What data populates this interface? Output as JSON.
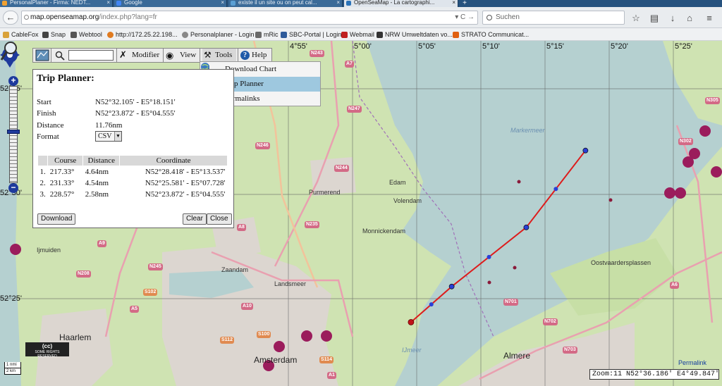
{
  "browser": {
    "tabs": [
      {
        "label": "PersonalPlaner - Firma: NEDT..."
      },
      {
        "label": "Google"
      },
      {
        "label": "existe il un site ou on peut cal..."
      },
      {
        "label": "OpenSeaMap - La cartographi..."
      }
    ],
    "url_host": "map.openseamap.org",
    "url_path": "/index.php?lang=fr",
    "search_placeholder": "Suchen",
    "bookmarks": [
      {
        "label": "CableFox",
        "color": "#d9a23a"
      },
      {
        "label": "Snap",
        "color": "#444444"
      },
      {
        "label": "Webtool",
        "color": "#555555"
      },
      {
        "label": "http://172.25.22.198...",
        "color": "#e07b20"
      },
      {
        "label": "Personalplaner - Login",
        "color": "#888888"
      },
      {
        "label": "mRic",
        "color": "#6a6a6a"
      },
      {
        "label": "SBC-Portal | Login",
        "color": "#2f5b9a"
      },
      {
        "label": "Webmail",
        "color": "#c02020"
      },
      {
        "label": "NRW Umweltdaten vo...",
        "color": "#333333"
      },
      {
        "label": "STRATO Communicat...",
        "color": "#e06010"
      }
    ]
  },
  "toolbar": {
    "modifier": "Modifier",
    "view": "View",
    "tools": "Tools",
    "help": "Help"
  },
  "tools_menu": {
    "items": [
      {
        "label": "Download Chart",
        "checked": false
      },
      {
        "label": "Trip Planner",
        "checked": true
      },
      {
        "label": "Permalinks",
        "checked": false
      }
    ]
  },
  "trip_planner": {
    "title": "Trip Planner:",
    "start_label": "Start",
    "start_value": "N52°32.105' - E5°18.151'",
    "finish_label": "Finish",
    "finish_value": "N52°23.872' - E5°04.555'",
    "distance_label": "Distance",
    "distance_value": "11.76nm",
    "format_label": "Format",
    "format_value": "CSV",
    "columns": [
      "",
      "Course",
      "Distance",
      "Coordinate"
    ],
    "rows": [
      {
        "n": "1.",
        "course": "217.33°",
        "distance": "4.64nm",
        "coord": "N52°28.418' - E5°13.537'"
      },
      {
        "n": "2.",
        "course": "231.33°",
        "distance": "4.54nm",
        "coord": "N52°25.581' - E5°07.728'"
      },
      {
        "n": "3.",
        "course": "228.57°",
        "distance": "2.58nm",
        "coord": "N52°23.872' - E5°04.555'"
      }
    ],
    "download_label": "Download",
    "clear_label": "Clear",
    "close_label": "Close"
  },
  "map": {
    "lon_labels": [
      "4°55'",
      "5°00'",
      "5°05'",
      "5°10'",
      "5°15'",
      "5°20'",
      "5°25'"
    ],
    "lat_labels": [
      "52°35'",
      "52°30'",
      "52°25'"
    ],
    "places": [
      {
        "name": "Ijmuiden",
        "cls": "place"
      },
      {
        "name": "Purmerend",
        "cls": "place"
      },
      {
        "name": "Edam",
        "cls": "place"
      },
      {
        "name": "Volendam",
        "cls": "place"
      },
      {
        "name": "Monnickendam",
        "cls": "place"
      },
      {
        "name": "Zaandam",
        "cls": "place"
      },
      {
        "name": "Landsmeer",
        "cls": "place"
      },
      {
        "name": "Haarlem",
        "cls": "place big"
      },
      {
        "name": "Amsterdam",
        "cls": "place big"
      },
      {
        "name": "Almere",
        "cls": "place big"
      },
      {
        "name": "Oostvaardersplassen",
        "cls": "place"
      },
      {
        "name": "Markermeer",
        "cls": "place water"
      },
      {
        "name": "IJmeer",
        "cls": "place water"
      }
    ],
    "roads": [
      "N243",
      "A7",
      "N247",
      "N244",
      "N246",
      "N235",
      "A8",
      "A9",
      "A10",
      "N208",
      "N245",
      "S102",
      "A5",
      "S100",
      "S112",
      "S114",
      "N701",
      "N702",
      "N703",
      "A6",
      "N302",
      "N305",
      "A1"
    ],
    "route": [
      [
        52.53508,
        5.30252
      ],
      [
        52.47363,
        5.22562
      ],
      [
        52.42635,
        5.1288
      ],
      [
        52.39787,
        5.07592
      ]
    ],
    "copyright": "SOME RIGHTS RESERVED",
    "scale_top": "1 nmi",
    "scale_bottom": "2 km",
    "permalink": "Permalink",
    "zoom_status": "Zoom:11 N52°36.186' E4°49.847'"
  }
}
